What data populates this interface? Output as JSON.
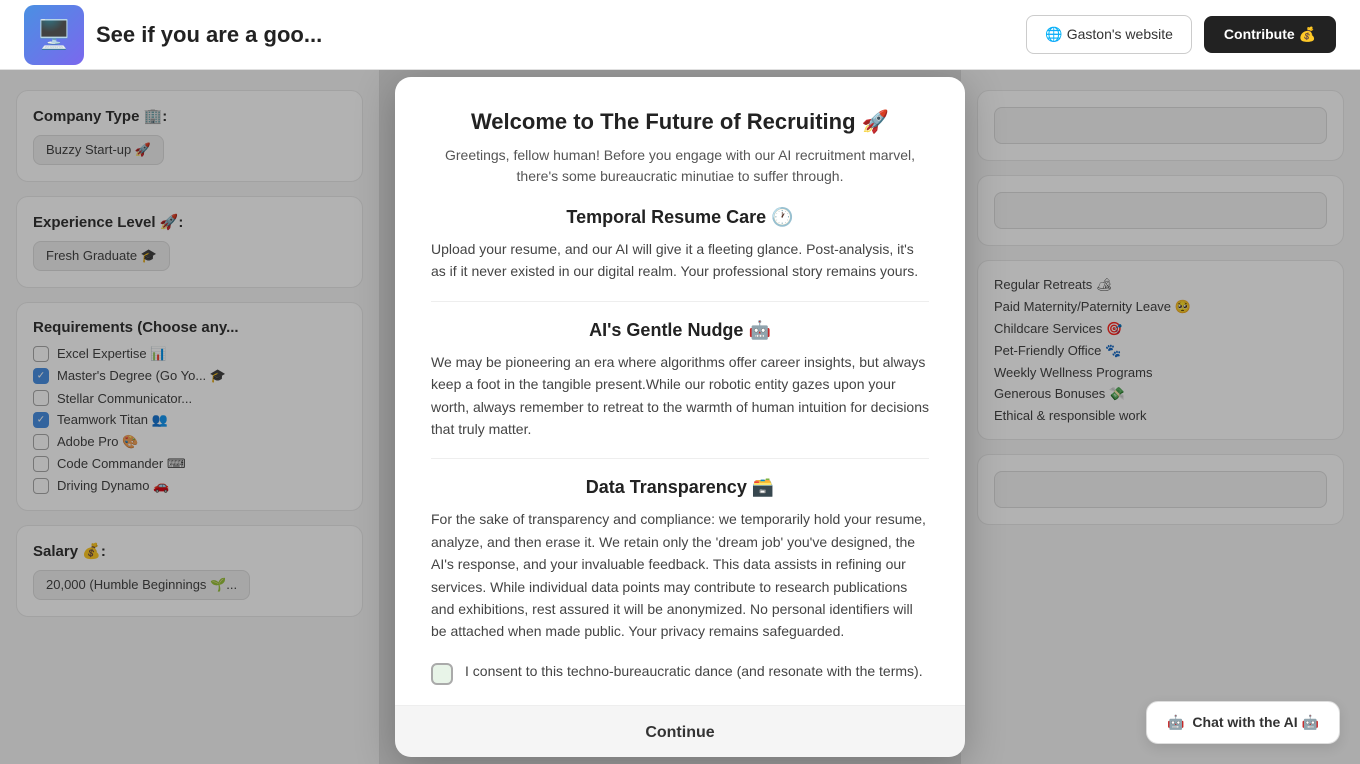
{
  "topnav": {
    "logo_emoji": "🖥️",
    "title": "See if you are a goo...",
    "website_label": "🌐  Gaston's website",
    "contribute_label": "Contribute 💰"
  },
  "sidebar_left": {
    "company_type_label": "Company Type 🏢:",
    "company_type_value": "Buzzy Start-up 🚀",
    "experience_label": "Experience Level 🚀:",
    "experience_value": "Fresh Graduate 🎓",
    "requirements_label": "Requirements (Choose any...",
    "requirements": [
      {
        "label": "Excel Expertise 📊",
        "checked": false
      },
      {
        "label": "Master's Degree (Go Yo...",
        "checked": true
      },
      {
        "label": "🎓",
        "checked": false
      },
      {
        "label": "Stellar Communicator...",
        "checked": false
      },
      {
        "label": "Teamwork Titan 👥",
        "checked": true
      },
      {
        "label": "Adobe Pro 🎨",
        "checked": false
      },
      {
        "label": "Code Commander ⌨",
        "checked": false
      },
      {
        "label": "Driving Dynamo 🚗",
        "checked": false
      }
    ],
    "salary_label": "Salary 💰:",
    "salary_value": "20,000 (Humble Beginnings 🌱..."
  },
  "modal": {
    "title": "Welcome to The Future of Recruiting 🚀",
    "intro": "Greetings, fellow human! Before you engage with our AI recruitment marvel, there's some bureaucratic minutiae to suffer through.",
    "temporal_title": "Temporal Resume Care 🕐",
    "temporal_body": "Upload your resume, and our AI will give it a fleeting glance. Post-analysis, it's as if it never existed in our digital realm. Your professional story remains yours.",
    "nudge_title": "AI's Gentle Nudge 🤖",
    "nudge_body": "We may be pioneering an era where algorithms offer career insights, but always keep a foot in the tangible present.While our robotic entity gazes upon your worth, always remember to retreat to the warmth of human intuition for decisions that truly matter.",
    "transparency_title": "Data Transparency 🗃️",
    "transparency_body": "For the sake of transparency and compliance: we temporarily hold your resume, analyze, and then erase it. We retain only the 'dream job' you've designed, the AI's response, and your invaluable feedback. This data assists in refining our services. While individual data points may contribute to research publications and exhibitions, rest assured it will be anonymized. No personal identifiers will be attached when made public. Your privacy remains safeguarded.",
    "consent_text": "I consent to this techno-bureaucratic dance (and resonate with the terms).",
    "continue_label": "Continue"
  },
  "sidebar_right": {
    "field1_placeholder": "",
    "field2_placeholder": "",
    "benefits_label": "",
    "benefits": [
      "Regular Retreats 🏕",
      "Paid Maternity/Paternity Leave 🥺",
      "Childcare Services 🎯",
      "Pet-Friendly Office 🐾",
      "Weekly Wellness Programs",
      "Generous Bonuses 💸",
      "Ethical & responsible work"
    ],
    "salary_field": ""
  },
  "chat_btn": {
    "label": "Chat with the AI 🤖"
  }
}
